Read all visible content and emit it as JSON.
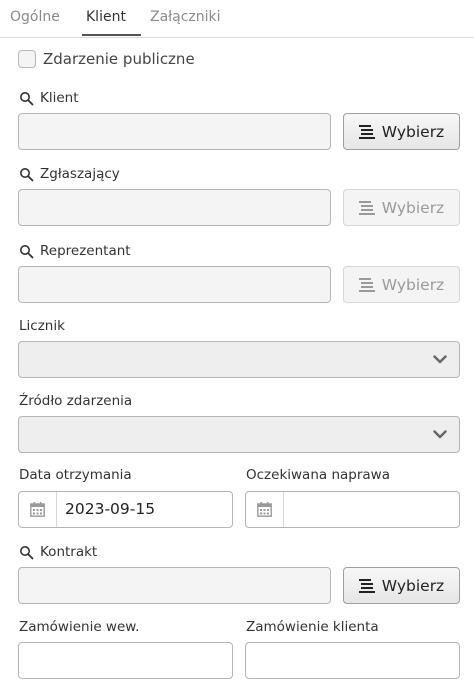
{
  "tabs": [
    {
      "label": "Ogólne"
    },
    {
      "label": "Klient",
      "active": true
    },
    {
      "label": "Załączniki"
    }
  ],
  "public_event": {
    "label": "Zdarzenie publiczne",
    "checked": false
  },
  "client": {
    "label": "Klient",
    "value": "",
    "button": "Wybierz"
  },
  "reporter": {
    "label": "Zgłaszający",
    "value": "",
    "button": "Wybierz",
    "button_disabled": true
  },
  "representative": {
    "label": "Reprezentant",
    "value": "",
    "button": "Wybierz",
    "button_disabled": true
  },
  "counter": {
    "label": "Licznik",
    "selected": ""
  },
  "event_source": {
    "label": "Źródło zdarzenia",
    "selected": ""
  },
  "received_date": {
    "label": "Data otrzymania",
    "value": "2023-09-15"
  },
  "expected_repair": {
    "label": "Oczekiwana naprawa",
    "value": ""
  },
  "contract": {
    "label": "Kontrakt",
    "value": "",
    "button": "Wybierz"
  },
  "internal_order": {
    "label": "Zamówienie wew.",
    "value": ""
  },
  "client_order": {
    "label": "Zamówienie klienta",
    "value": ""
  },
  "icons": {
    "search": "search-icon",
    "list": "list-icon",
    "calendar": "calendar-icon",
    "chevron": "chevron-down-icon"
  }
}
